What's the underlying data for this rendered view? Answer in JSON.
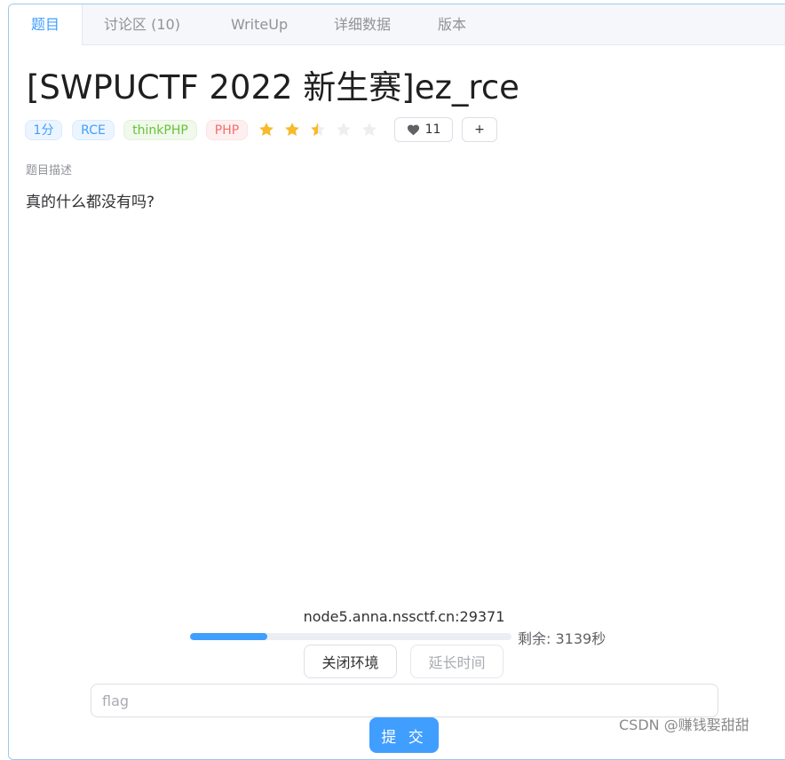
{
  "tabs": [
    {
      "label": "题目",
      "active": true
    },
    {
      "label": "讨论区 (10)"
    },
    {
      "label": "WriteUp"
    },
    {
      "label": "详细数据"
    },
    {
      "label": "版本"
    }
  ],
  "problem": {
    "title": "[SWPUCTF 2022 新生赛]ez_rce",
    "tags": [
      {
        "label": "1分",
        "color": "blue"
      },
      {
        "label": "RCE",
        "color": "blue"
      },
      {
        "label": "thinkPHP",
        "color": "green"
      },
      {
        "label": "PHP",
        "color": "red"
      }
    ],
    "difficulty_rating": 2.5,
    "difficulty_max": 5,
    "star_icon": "star-icon",
    "likes": "11",
    "like_icon": "heart-icon",
    "add_label": "+",
    "description_label": "题目描述",
    "description": "真的什么都没有吗?"
  },
  "environment": {
    "host": "node5.anna.nssctf.cn:29371",
    "progress_fraction": 0.24,
    "remaining_text": "剩余: 3139秒",
    "close_button": "关闭环境",
    "extend_button": "延长时间"
  },
  "flag_form": {
    "placeholder": "flag",
    "submit_label": "提 交"
  },
  "watermark": "CSDN @赚钱娶甜甜",
  "colors": {
    "accent": "#409eff",
    "star_filled": "#f7ba2a",
    "star_empty": "#eeeeee"
  }
}
